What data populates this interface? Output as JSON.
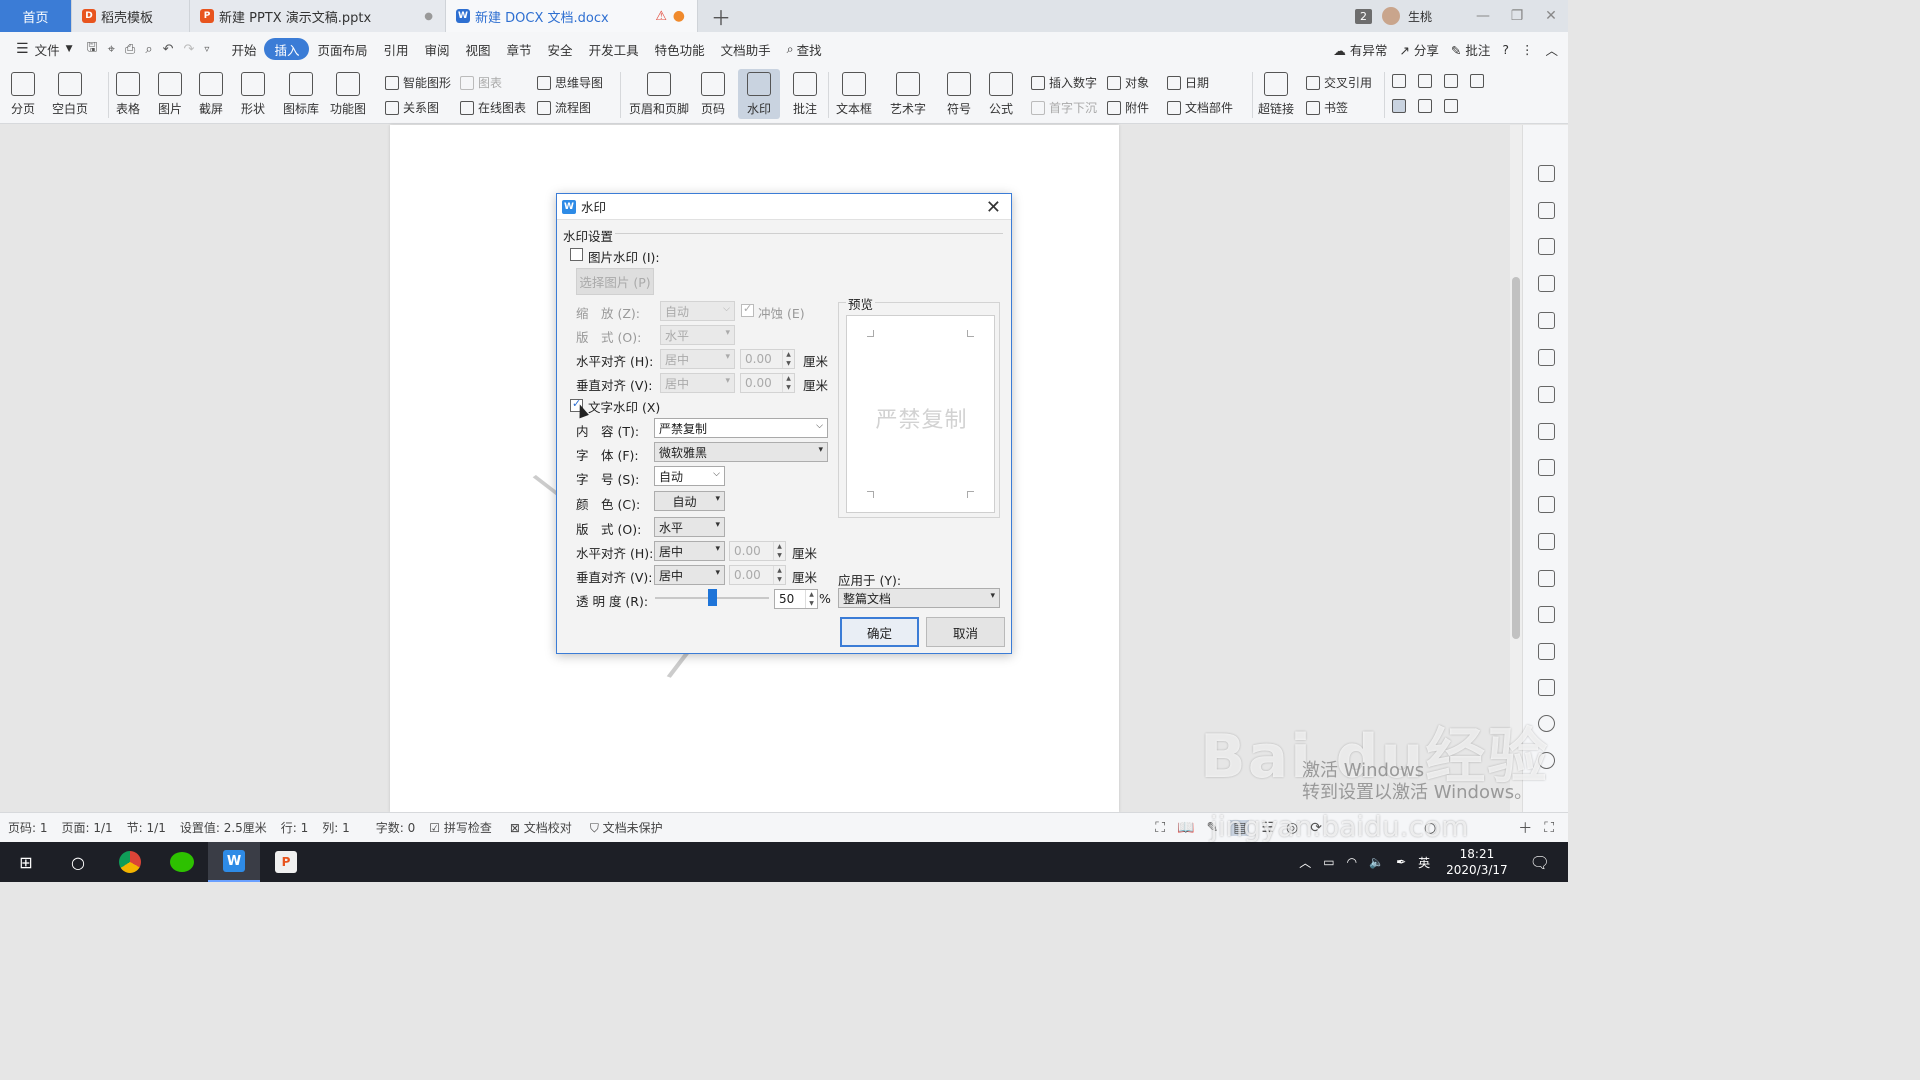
{
  "tabs": [
    {
      "label": "首页",
      "active": true
    },
    {
      "label": "稻壳模板"
    },
    {
      "label": "新建 PPTX 演示文稿.pptx"
    },
    {
      "label": "新建 DOCX 文档.docx"
    }
  ],
  "titlebar": {
    "count": "2",
    "user": "生桃"
  },
  "menu": {
    "file": "文件",
    "items": [
      "开始",
      "插入",
      "页面布局",
      "引用",
      "审阅",
      "视图",
      "章节",
      "安全",
      "开发工具",
      "特色功能",
      "文档助手",
      "查找"
    ],
    "right": [
      "有异常",
      "分享",
      "批注"
    ]
  },
  "ribbon": {
    "big": [
      "分页",
      "空白页",
      "表格",
      "图片",
      "截屏",
      "形状",
      "图标库",
      "功能图",
      "页眉和页脚",
      "页码",
      "水印",
      "批注",
      "文本框",
      "艺术字",
      "符号",
      "公式",
      "超链接"
    ],
    "small": [
      "智能图形",
      "图表",
      "思维导图",
      "关系图",
      "在线图表",
      "流程图",
      "插入数字",
      "对象",
      "日期",
      "首字下沉",
      "附件",
      "文档部件",
      "交叉引用",
      "书签"
    ]
  },
  "dialog": {
    "title": "水印",
    "group": "水印设置",
    "pic_watermark": "图片水印 (I):",
    "select_pic": "选择图片 (P)",
    "scale_label": "缩　放 (Z):",
    "scale_value": "自动",
    "washout": "冲蚀 (E)",
    "layout_label": "版　式 (O):",
    "layout_value": "水平",
    "halign_label": "水平对齐 (H):",
    "halign_value": "居中",
    "valign_label": "垂直对齐 (V):",
    "valign_value": "居中",
    "offset_value": "0.00",
    "unit": "厘米",
    "text_watermark": "文字水印 (X)",
    "content_label": "内　容 (T):",
    "content_value": "严禁复制",
    "font_label": "字　体 (F):",
    "font_value": "微软雅黑",
    "size_label": "字　号 (S):",
    "size_value": "自动",
    "color_label": "颜　色 (C):",
    "color_value": "自动",
    "layout2_label": "版　式 (O):",
    "layout2_value": "水平",
    "halign2_label": "水平对齐 (H):",
    "halign2_value": "居中",
    "valign2_label": "垂直对齐 (V):",
    "valign2_value": "居中",
    "transparency_label": "透 明 度 (R):",
    "transparency_value": "50",
    "transparency_fraction": 0.5,
    "percent": "%",
    "preview_label": "预览",
    "preview_text": "严禁复制",
    "apply_label": "应用于 (Y):",
    "apply_value": "整篇文档",
    "ok": "确定",
    "cancel": "取消"
  },
  "status": {
    "page": "页码: 1",
    "pages": "页面: 1/1",
    "section": "节: 1/1",
    "setting": "设置值: 2.5厘米",
    "row": "行: 1",
    "col": "列: 1",
    "words": "字数: 0",
    "spell": "拼写检查",
    "proof": "文档校对",
    "protect": "文档未保护"
  },
  "taskbar": {
    "time": "18:21",
    "date": "2020/3/17",
    "ime": "英"
  },
  "overlay": {
    "baidu": "Bai du经验",
    "site": "jingyan.baidu.com",
    "activate": "激活 Windows\n转到设置以激活 Windows。"
  },
  "colors": {
    "accent": "#3b7cd6",
    "slider": "#1e74d8"
  }
}
